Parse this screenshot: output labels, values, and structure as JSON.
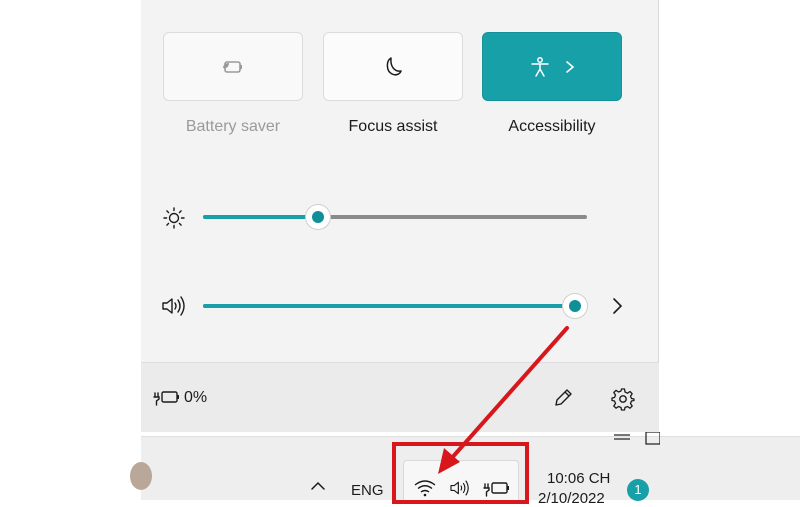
{
  "quick_settings": {
    "tiles": [
      {
        "label": "Battery saver",
        "state": "disabled",
        "icon": "battery-saver-icon"
      },
      {
        "label": "Focus assist",
        "state": "off",
        "icon": "moon-icon"
      },
      {
        "label": "Accessibility",
        "state": "on",
        "icon": "accessibility-icon",
        "has_chevron": true
      }
    ],
    "brightness": {
      "icon": "sun-icon",
      "level": 0.3
    },
    "volume": {
      "icon": "speaker-icon",
      "level": 0.97
    },
    "footer": {
      "battery_percent": "0%",
      "battery_icon": "plugged-battery-icon",
      "edit_icon": "pencil-icon",
      "settings_icon": "gear-icon"
    }
  },
  "taskbar": {
    "language": "ENG",
    "time": "10:06 CH",
    "date": "2/10/2022",
    "notification_count": "1",
    "tray_icons": [
      "wifi-icon",
      "speaker-icon",
      "plugged-battery-icon"
    ]
  },
  "colors": {
    "accent": "#17a0a8",
    "annotation_red": "#d8171d"
  }
}
